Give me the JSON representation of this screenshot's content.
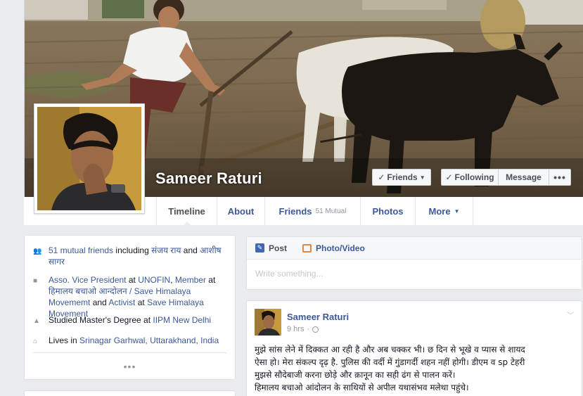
{
  "profile": {
    "name": "Sameer Raturi",
    "buttons": {
      "friends": "Friends",
      "following": "Following",
      "message": "Message",
      "more": "•••"
    }
  },
  "nav": {
    "timeline": "Timeline",
    "about": "About",
    "friends": "Friends",
    "friends_count": "51 Mutual",
    "photos": "Photos",
    "more": "More"
  },
  "intro": {
    "mutual": {
      "count": "51 mutual friends",
      "including": "including",
      "friend1": "संजय राय",
      "and": "and",
      "friend2": "आशीष सागर"
    },
    "work": {
      "role1": "Asso. Vice President",
      "at1": "at",
      "org1": "UNOFIN",
      "sep1": ",",
      "role2": "Member",
      "at2": "at",
      "org2": "हिमालय बचाओ आन्दोलन / Save Himalaya Movememt",
      "and": "and",
      "role3": "Activist",
      "at3": "at",
      "org3": "Save Himalaya Movement"
    },
    "education": {
      "text": "Studied Master's Degree at",
      "school": "IIPM New Delhi"
    },
    "lives": {
      "text": "Lives in",
      "place": "Srinagar Garhwal, Uttarakhand, India"
    },
    "more": "•••"
  },
  "composer": {
    "post_tab": "Post",
    "photo_tab": "Photo/Video",
    "placeholder": "Write something..."
  },
  "post": {
    "author": "Sameer Raturi",
    "time": "9 hrs",
    "dot": "·",
    "text_lines": [
      "मुझे सांस लेने में दिक्कत आ रही है और अब चक्कर भी। छ दिन से भूखे व प्यास से शायद",
      "ऐसा हो। मेरा संकल्प दृढ़ है. पुलिस की वर्दी में गुंडागर्दी शहन नहीं होगी। डीएम व sp टेहरी",
      "मुझसे सौदेबाजी करना छोड़े और क़ानून का सही ढंग से पालन करें।",
      "हिमालय बचाओ आंदोलन के साथियों से अपील यथासंभव मलेथा पहुंचे।"
    ]
  },
  "colors": {
    "link": "#3b5998",
    "page_bg": "#e9ebee",
    "muted": "#9197a3"
  }
}
